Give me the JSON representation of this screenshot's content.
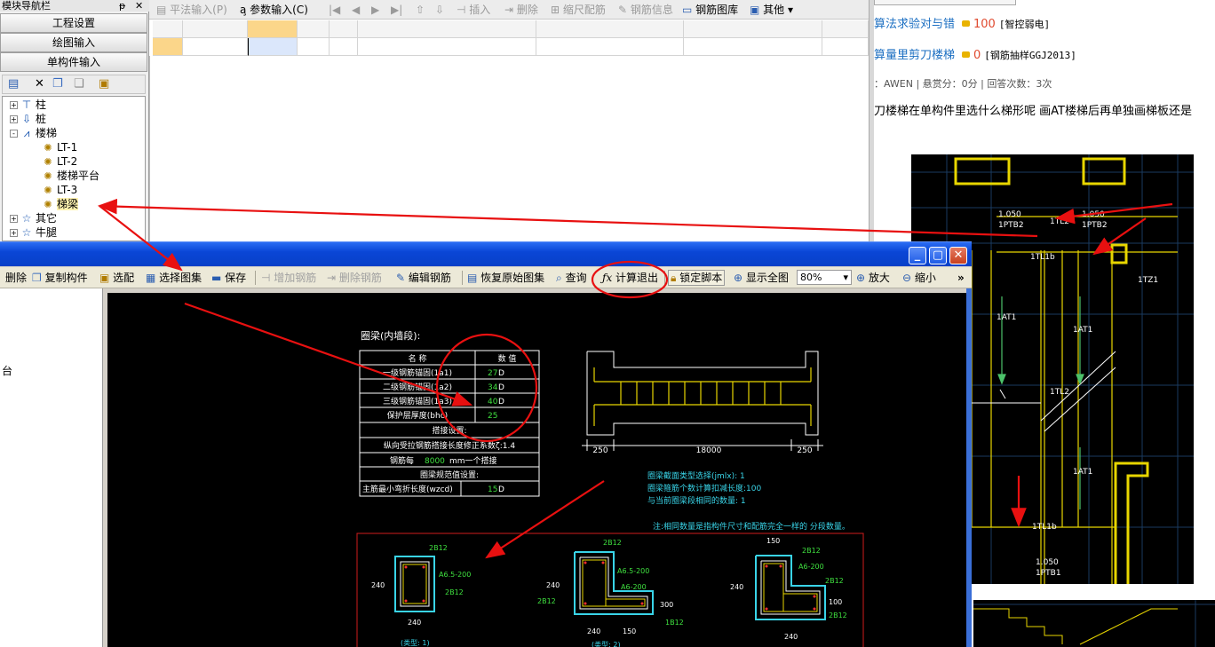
{
  "nav": {
    "title": "模块导航栏",
    "pin": "ᵽ",
    "close": "✕",
    "buttons": [
      "工程设置",
      "绘图输入",
      "单构件输入"
    ],
    "tree": [
      {
        "label": "柱",
        "exp": "+",
        "icon": "column-icon"
      },
      {
        "label": "桩",
        "exp": "+",
        "icon": "pile-icon"
      },
      {
        "label": "楼梯",
        "exp": "-",
        "icon": "stair-icon"
      },
      {
        "label": "LT-1",
        "icon": "gear-icon"
      },
      {
        "label": "LT-2",
        "icon": "gear-icon"
      },
      {
        "label": "楼梯平台",
        "icon": "gear-icon"
      },
      {
        "label": "LT-3",
        "icon": "gear-icon"
      },
      {
        "label": "梯梁",
        "icon": "gear-icon"
      },
      {
        "label": "其它",
        "exp": "+",
        "icon": "star-icon"
      },
      {
        "label": "牛腿",
        "exp": "+",
        "icon": "star-icon"
      }
    ]
  },
  "topbar": {
    "items": [
      "平法输入(P)",
      "参数输入(C)",
      "插入",
      "删除",
      "缩尺配筋",
      "钢筋信息",
      "钢筋图库",
      "其他"
    ]
  },
  "web": {
    "questions": [
      {
        "title": "算法求验对与错",
        "score": "100",
        "category": "[智控弱电]"
      },
      {
        "title": "算量里剪刀楼梯",
        "score": "0",
        "category": "[钢筋抽样GGJ2013]"
      }
    ],
    "meta": "：AWEN  |  悬赏分：0分  |  回答次数：3次",
    "question_text": "刀楼梯在单构件里选什么梯形呢   画AT楼梯后再单独画梯板还是"
  },
  "dialog": {
    "toolbar": [
      "删除",
      "复制构件",
      "选配",
      "选择图集",
      "保存",
      "增加钢筋",
      "删除钢筋",
      "编辑钢筋",
      "恢复原始图集",
      "查询",
      "计算退出",
      "锁定脚本",
      "显示全图",
      "放大",
      "缩小"
    ],
    "zoom": "80%",
    "more": "»",
    "left_text": "台"
  },
  "cad": {
    "title": "圈梁(内墙段):",
    "table_header": [
      "名  称",
      "数  值"
    ],
    "rows": [
      {
        "name": "一级钢筋锚固(1a1)",
        "value": "27",
        "unit": "D"
      },
      {
        "name": "二级钢筋锚固(1a2)",
        "value": "34",
        "unit": "D"
      },
      {
        "name": "三级钢筋锚固(1a3)",
        "value": "40",
        "unit": "D"
      },
      {
        "name": "保护层厚度(bhc)",
        "value": "25",
        "unit": ""
      }
    ],
    "lap_title": "搭接设置:",
    "lap_row": "纵向受拉钢筋搭接长度修正系数ζ:1.4",
    "lap_row2_pre": "钢筋每",
    "lap_row2_val": "8000",
    "lap_row2_post": "mm一个搭接",
    "spec_title": "圈梁规范值设置:",
    "spec_row_name": "主筋最小弯折长度(wzcd)",
    "spec_row_val": "15",
    "spec_row_unit": "D",
    "dims": [
      "250",
      "18000",
      "250"
    ],
    "notes": [
      "圈梁截面类型选择(jmlx): 1",
      "圈梁箍筋个数计算扣减长度:100",
      "与当前圈梁段相同的数量: 1"
    ],
    "footnote": "注:相同数量是指构件尺寸和配筋完全一样的 分段数量。",
    "sec1": {
      "top": "2B12",
      "stir": "A6.5-200",
      "side": "2B12",
      "h": "240",
      "w": "240",
      "cap": "(类型: 1)"
    },
    "sec2": {
      "top": "2B12",
      "stir": "A6.5-200",
      "stir2": "A6-200",
      "left": "2B12",
      "h": "240",
      "h2": "300",
      "b": "1B12",
      "w": "240",
      "w2": "150",
      "cap": "(类型: 2)"
    },
    "sec3": {
      "top": "150",
      "top2": "2B12",
      "stir": "A6-200",
      "right": "2B12",
      "h": "240",
      "h2": "100",
      "right2": "2B12",
      "w": "240"
    }
  },
  "cad_right": {
    "labels": [
      "1.050",
      "1PTB2",
      "1.050",
      "1PTB2",
      "1TL2",
      "1TL1b",
      "1TZ1",
      "1AT1",
      "1AT1",
      "1TL2",
      "1AT1",
      "1TL1b",
      "1.050",
      "1PTB1"
    ]
  }
}
